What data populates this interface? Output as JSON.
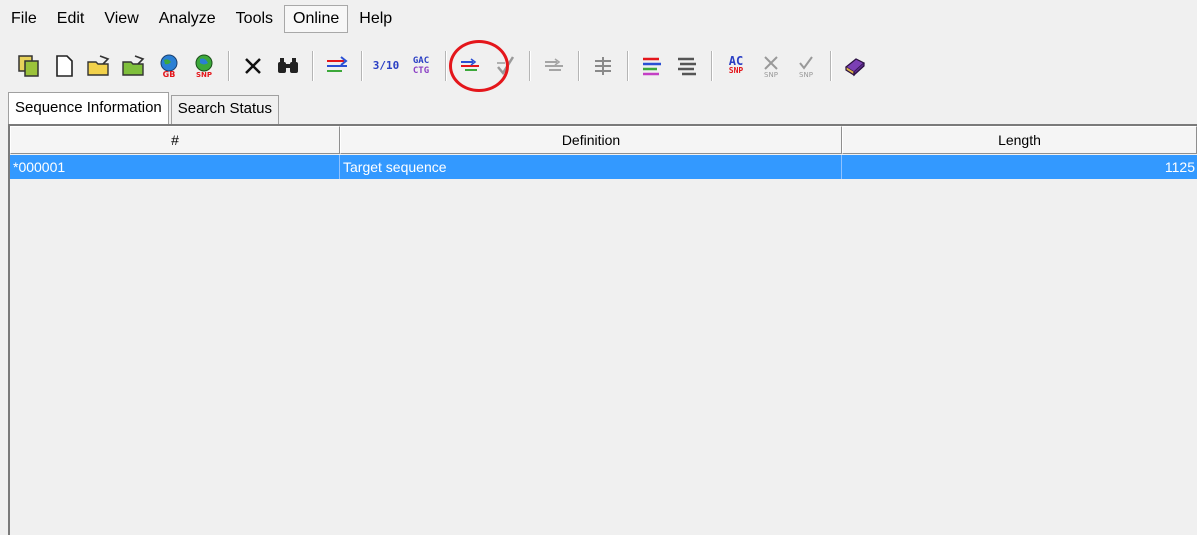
{
  "menu": {
    "items": [
      "File",
      "Edit",
      "View",
      "Analyze",
      "Tools",
      "Online",
      "Help"
    ],
    "active": "Online"
  },
  "toolbar": {
    "icon_ratio": "3/10",
    "icon_gac_top": "GAC",
    "icon_gac_bottom": "CTG",
    "icon_ac": "AC",
    "icon_snp": "SNP",
    "icon_snp_small": "SNP",
    "icon_gb": "GB",
    "highlight_color": "#e4161b"
  },
  "tabs": [
    "Sequence Information",
    "Search Status"
  ],
  "grid": {
    "columns": [
      "#",
      "Definition",
      "Length"
    ],
    "rows": [
      {
        "num": "*000001",
        "definition": "Target sequence",
        "length": "1125"
      }
    ],
    "selection_color": "#3399ff"
  }
}
